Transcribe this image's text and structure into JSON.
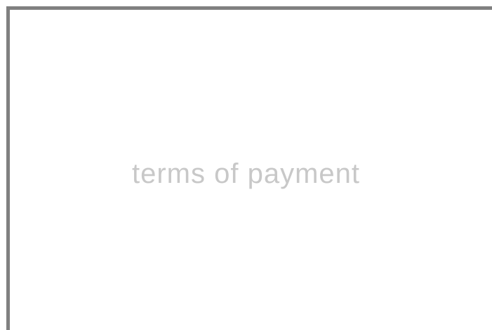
{
  "panel": {
    "caption": "terms of payment"
  },
  "colors": {
    "frame_border": "#808080",
    "caption_text": "#c8c8c8",
    "background": "#ffffff"
  }
}
